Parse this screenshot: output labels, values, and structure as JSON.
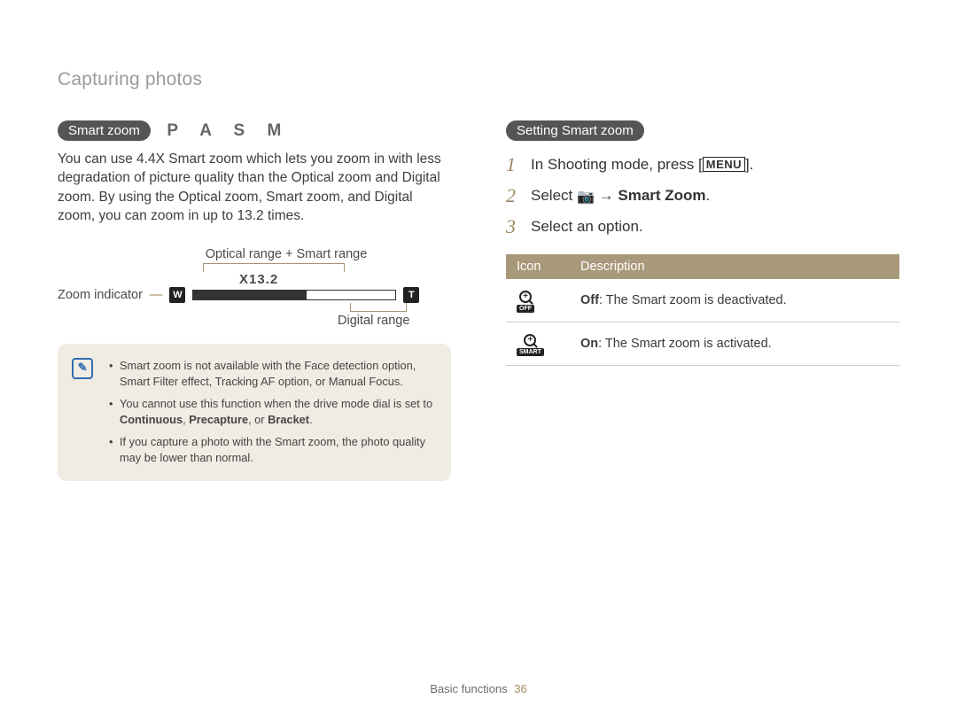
{
  "header": "Capturing photos",
  "left": {
    "pill": "Smart zoom",
    "modes": "P A S M",
    "para": "You can use 4.4X Smart zoom which lets you zoom in with less degradation of picture quality than the Optical zoom and Digital zoom. By using the Optical zoom, Smart zoom, and Digital zoom, you can zoom in up to 13.2 times.",
    "diagram": {
      "top_label": "Optical range + Smart range",
      "zoom_label": "X13.2",
      "zoom_indicator": "Zoom indicator",
      "w": "W",
      "t": "T",
      "bottom_label": "Digital range"
    },
    "notes": {
      "n1": "Smart zoom is not available with the Face detection option, Smart Filter effect, Tracking AF option, or Manual Focus.",
      "n2a": "You cannot use this function when the drive mode dial is set to ",
      "n2b_bold": "Continuous",
      "n2c": ", ",
      "n2d_bold": "Precapture",
      "n2e": ", or ",
      "n2f_bold": "Bracket",
      "n2g": ".",
      "n3": "If you capture a photo with the Smart zoom, the photo quality may be lower than normal."
    }
  },
  "right": {
    "pill": "Setting Smart zoom",
    "steps": {
      "s1_pre": "In Shooting mode, press [",
      "s1_menu": "MENU",
      "s1_post": "].",
      "s2_pre": "Select ",
      "s2_arrow": " → ",
      "s2_bold": "Smart Zoom",
      "s2_post": ".",
      "s3": "Select an option."
    },
    "table": {
      "h1": "Icon",
      "h2": "Description",
      "r1_sub": "OFF",
      "r1_bold": "Off",
      "r1_rest": ": The Smart zoom is deactivated.",
      "r2_sub": "SMART",
      "r2_bold": "On",
      "r2_rest": ": The Smart zoom is activated."
    }
  },
  "footer": {
    "section": "Basic functions",
    "page": "36"
  }
}
